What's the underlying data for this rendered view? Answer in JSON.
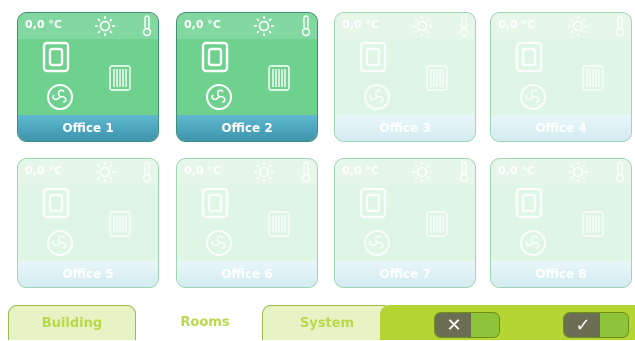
{
  "rooms": [
    {
      "name": "Office 1",
      "temp": "0,0 °C",
      "state": "active"
    },
    {
      "name": "Office 2",
      "temp": "0,0 °C",
      "state": "active"
    },
    {
      "name": "Office 3",
      "temp": "0,0 °C",
      "state": "inactive"
    },
    {
      "name": "Office 4",
      "temp": "0,0 °C",
      "state": "inactive"
    },
    {
      "name": "Office 5",
      "temp": "0,0 °C",
      "state": "inactive"
    },
    {
      "name": "Office 6",
      "temp": "0,0 °C",
      "state": "inactive"
    },
    {
      "name": "Office 7",
      "temp": "0,0 °C",
      "state": "inactive"
    },
    {
      "name": "Office 8",
      "temp": "0,0 °C",
      "state": "inactive"
    }
  ],
  "tile_icons": [
    "sun-icon",
    "thermometer-icon",
    "window-icon",
    "radiator-icon",
    "fan-icon"
  ],
  "tabs": [
    {
      "label": "Building",
      "selected": false
    },
    {
      "label": "Rooms",
      "selected": true
    },
    {
      "label": "System",
      "selected": false
    }
  ],
  "actions": {
    "cancel_glyph": "✕",
    "confirm_glyph": "✓"
  },
  "colors": {
    "active_tile": "#6ed18e",
    "inactive_tile": "#dff5e5",
    "active_bar": "#3d95ad",
    "tab_accent": "#b4d533"
  }
}
